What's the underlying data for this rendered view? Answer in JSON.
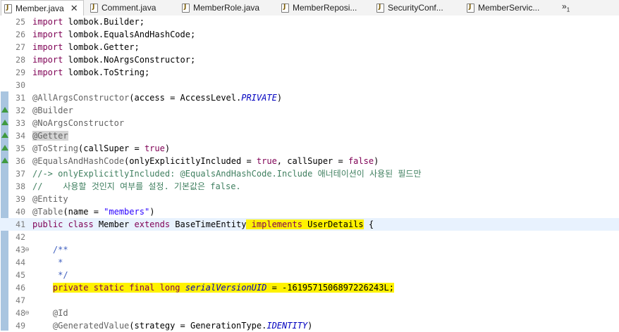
{
  "tabs": [
    {
      "label": "Member.java",
      "active": true
    },
    {
      "label": "Comment.java"
    },
    {
      "label": "MemberRole.java"
    },
    {
      "label": "MemberReposi..."
    },
    {
      "label": "SecurityConf..."
    },
    {
      "label": "MemberServic..."
    }
  ],
  "overflow": {
    "label": "»",
    "count": "1"
  },
  "lines": [
    {
      "n": "25",
      "tokens": [
        {
          "t": "kw",
          "v": "import"
        },
        {
          "t": "plain",
          "v": " lombok.Builder;"
        }
      ]
    },
    {
      "n": "26",
      "tokens": [
        {
          "t": "kw",
          "v": "import"
        },
        {
          "t": "plain",
          "v": " lombok.EqualsAndHashCode;"
        }
      ]
    },
    {
      "n": "27",
      "tokens": [
        {
          "t": "kw",
          "v": "import"
        },
        {
          "t": "plain",
          "v": " lombok.Getter;"
        }
      ]
    },
    {
      "n": "28",
      "tokens": [
        {
          "t": "kw",
          "v": "import"
        },
        {
          "t": "plain",
          "v": " lombok.NoArgsConstructor;"
        }
      ]
    },
    {
      "n": "29",
      "tokens": [
        {
          "t": "kw",
          "v": "import"
        },
        {
          "t": "plain",
          "v": " lombok.ToString;"
        }
      ]
    },
    {
      "n": "30",
      "tokens": []
    },
    {
      "n": "31",
      "tokens": [
        {
          "t": "ann",
          "v": "@AllArgsConstructor"
        },
        {
          "t": "plain",
          "v": "(access = AccessLevel."
        },
        {
          "t": "ital",
          "v": "PRIVATE"
        },
        {
          "t": "plain",
          "v": ")"
        }
      ]
    },
    {
      "n": "32",
      "marker": true,
      "tokens": [
        {
          "t": "ann",
          "v": "@Builder"
        }
      ]
    },
    {
      "n": "33",
      "marker": true,
      "tokens": [
        {
          "t": "ann",
          "v": "@NoArgsConstructor"
        }
      ]
    },
    {
      "n": "34",
      "marker": true,
      "tokens": [
        {
          "t": "getterhl",
          "v": "@Getter"
        }
      ]
    },
    {
      "n": "35",
      "marker": true,
      "tokens": [
        {
          "t": "ann",
          "v": "@ToString"
        },
        {
          "t": "plain",
          "v": "(callSuper = "
        },
        {
          "t": "kw",
          "v": "true"
        },
        {
          "t": "plain",
          "v": ")"
        }
      ]
    },
    {
      "n": "36",
      "marker": true,
      "tokens": [
        {
          "t": "ann",
          "v": "@EqualsAndHashCode"
        },
        {
          "t": "plain",
          "v": "(onlyExplicitlyIncluded = "
        },
        {
          "t": "kw",
          "v": "true"
        },
        {
          "t": "plain",
          "v": ", callSuper = "
        },
        {
          "t": "kw",
          "v": "false"
        },
        {
          "t": "plain",
          "v": ")"
        }
      ]
    },
    {
      "n": "37",
      "tokens": [
        {
          "t": "cm",
          "v": "//-> onlyExplicitlyIncluded: @EqualsAndHashCode.Include 애너테이션이 사용된 필드만"
        }
      ]
    },
    {
      "n": "38",
      "tokens": [
        {
          "t": "cm",
          "v": "//    사용할 것인지 여부를 설정. 기본값은 false."
        }
      ]
    },
    {
      "n": "39",
      "tokens": [
        {
          "t": "ann",
          "v": "@Entity"
        }
      ]
    },
    {
      "n": "40",
      "tokens": [
        {
          "t": "ann",
          "v": "@Table"
        },
        {
          "t": "plain",
          "v": "(name = "
        },
        {
          "t": "str",
          "v": "\"members\""
        },
        {
          "t": "plain",
          "v": ")"
        }
      ]
    },
    {
      "n": "41",
      "current": true,
      "tokens": [
        {
          "t": "kw",
          "v": "public class"
        },
        {
          "t": "plain",
          "v": " Member "
        },
        {
          "t": "kw",
          "v": "extends"
        },
        {
          "t": "plain",
          "v": " BaseTimeEntity"
        },
        {
          "t": "hlkw",
          "v": " implements "
        },
        {
          "t": "hl",
          "v": "UserDetails"
        },
        {
          "t": "plain",
          "v": " {"
        }
      ]
    },
    {
      "n": "42",
      "tokens": []
    },
    {
      "n": "43",
      "fold": true,
      "tokens": [
        {
          "t": "jd",
          "v": "    /**"
        }
      ]
    },
    {
      "n": "44",
      "tokens": [
        {
          "t": "jd",
          "v": "     *"
        }
      ]
    },
    {
      "n": "45",
      "tokens": [
        {
          "t": "jd",
          "v": "     */"
        }
      ]
    },
    {
      "n": "46",
      "tokens": [
        {
          "t": "plain",
          "v": "    "
        },
        {
          "t": "hlkw",
          "v": "private static final long "
        },
        {
          "t": "hlfield",
          "v": "serialVersionUID"
        },
        {
          "t": "hl",
          "v": " = -1619571506897226243L;"
        }
      ]
    },
    {
      "n": "47",
      "tokens": []
    },
    {
      "n": "48",
      "fold": true,
      "tokens": [
        {
          "t": "ann",
          "v": "    @Id"
        }
      ]
    },
    {
      "n": "49",
      "tokens": [
        {
          "t": "ann",
          "v": "    @GeneratedValue"
        },
        {
          "t": "plain",
          "v": "(strategy = GenerationType."
        },
        {
          "t": "ital",
          "v": "IDENTITY"
        },
        {
          "t": "plain",
          "v": ")"
        }
      ]
    }
  ]
}
